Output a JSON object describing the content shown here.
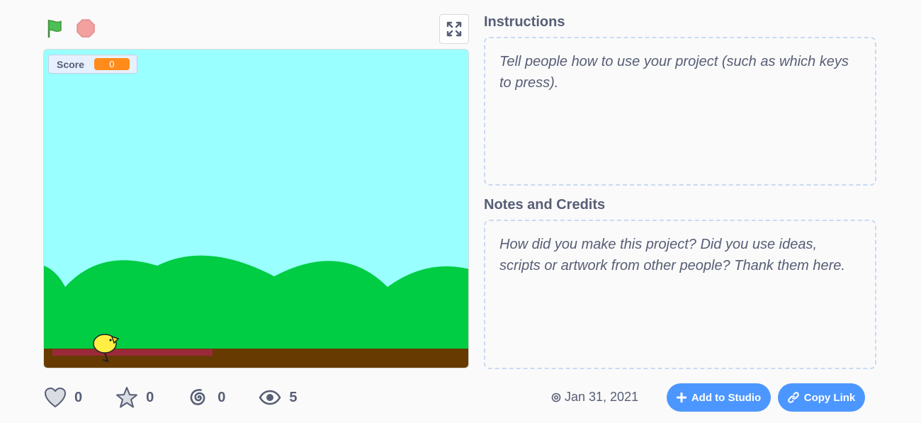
{
  "controls": {
    "green_flag_icon": "green-flag-icon",
    "stop_icon": "stop-sign-icon",
    "fullscreen_icon": "fullscreen-icon"
  },
  "stage": {
    "score_monitor": {
      "label": "Score",
      "value": "0"
    },
    "colors": {
      "sky": "#99ffff",
      "hills": "#00cc44",
      "ground": "#663a00",
      "platform": "#9a2a3a",
      "bird": "#ffee44"
    }
  },
  "instructions": {
    "title": "Instructions",
    "placeholder": "Tell people how to use your project (such as which keys to press)."
  },
  "notes": {
    "title": "Notes and Credits",
    "placeholder": "How did you make this project? Did you use ideas, scripts or artwork from other people? Thank them here."
  },
  "stats": {
    "loves": "0",
    "favorites": "0",
    "remixes": "0",
    "views": "5"
  },
  "shared_date": "Jan 31, 2021",
  "buttons": {
    "add_to_studio": "Add to Studio",
    "copy_link": "Copy Link"
  },
  "accent": "#4c97ff"
}
